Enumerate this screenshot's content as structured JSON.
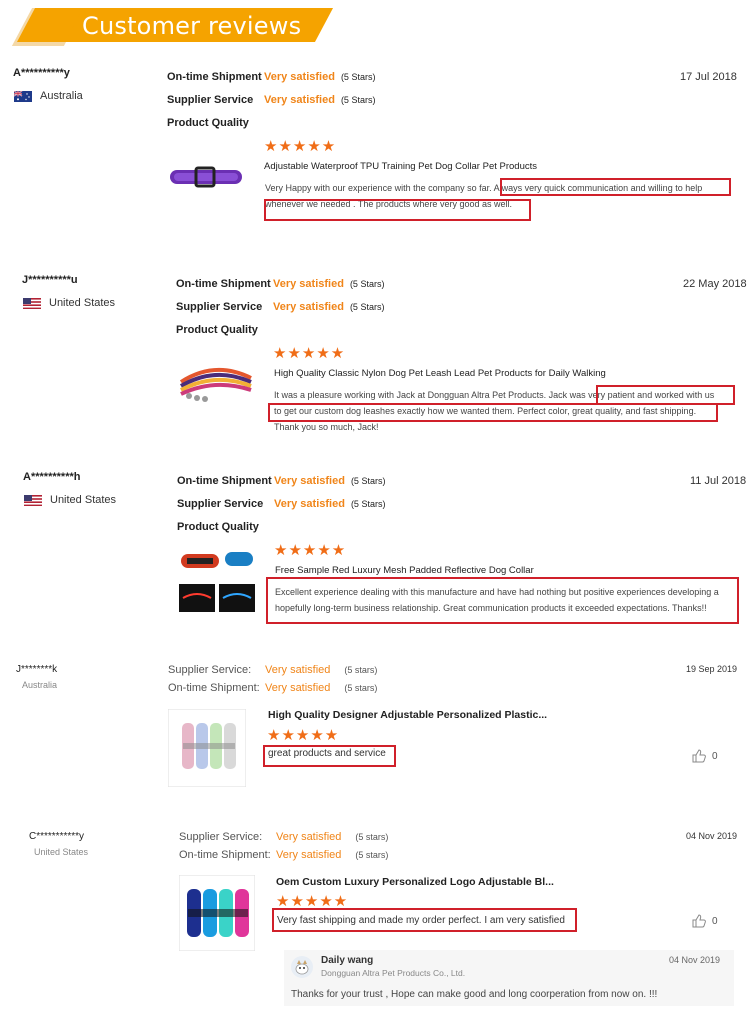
{
  "banner": {
    "title": "Customer reviews"
  },
  "reviews": [
    {
      "user": "A**********y",
      "country": "Australia",
      "date": "17 Jul 2018",
      "m1": {
        "label": "On-time Shipment",
        "value": "Very satisfied",
        "stars": "(5 Stars)"
      },
      "m2": {
        "label": "Supplier Service",
        "value": "Very satisfied",
        "stars": "(5 Stars)"
      },
      "quality_label": "Product Quality",
      "rating_stars": "★★★★★",
      "product": "Adjustable Waterproof TPU Training Pet Dog Collar Pet Products",
      "c1": "Very Happy with our experience with the company so far. Always very quick communication and willing to help",
      "c2": "whenever we needed . The products where very good as well."
    },
    {
      "user": "J**********u",
      "country": "United States",
      "date": "22 May 2018",
      "m1": {
        "label": "On-time Shipment",
        "value": "Very satisfied",
        "stars": "(5 Stars)"
      },
      "m2": {
        "label": "Supplier Service",
        "value": "Very satisfied",
        "stars": "(5 Stars)"
      },
      "quality_label": "Product Quality",
      "rating_stars": "★★★★★",
      "product": "High Quality Classic Nylon Dog Pet Leash Lead Pet Products for Daily Walking",
      "c1": "It was a pleasure working with Jack at Dongguan Altra Pet Products. Jack was very patient and worked with us",
      "c2": "to get our custom dog leashes exactly how we wanted them. Perfect color, great quality, and fast shipping.",
      "c3": "Thank you so much, Jack!"
    },
    {
      "user": "A**********h",
      "country": "United States",
      "date": "11 Jul 2018",
      "m1": {
        "label": "On-time Shipment",
        "value": "Very satisfied",
        "stars": "(5 Stars)"
      },
      "m2": {
        "label": "Supplier Service",
        "value": "Very satisfied",
        "stars": "(5 Stars)"
      },
      "quality_label": "Product Quality",
      "rating_stars": "★★★★★",
      "product": "Free Sample Red Luxury Mesh Padded Reflective Dog Collar",
      "c1": "Excellent experience dealing with this manufacture and have had nothing but positive experiences developing a",
      "c2": "hopefully long-term business relationship. Great communication products it exceeded expectations. Thanks!!"
    },
    {
      "user": "J********k",
      "country": "Australia",
      "date": "19 Sep 2019",
      "m1": {
        "label": "Supplier Service:",
        "value": "Very satisfied",
        "stars": "(5 stars)"
      },
      "m2": {
        "label": "On-time Shipment:",
        "value": "Very satisfied",
        "stars": "(5 stars)"
      },
      "rating_stars": "★★★★★",
      "product": "High Quality Designer Adjustable Personalized Plastic...",
      "c1": "great products and service",
      "likes": "0"
    },
    {
      "user": "C***********y",
      "country": "United States",
      "date": "04 Nov 2019",
      "m1": {
        "label": "Supplier Service:",
        "value": "Very satisfied",
        "stars": "(5 stars)"
      },
      "m2": {
        "label": "On-time Shipment:",
        "value": "Very satisfied",
        "stars": "(5 stars)"
      },
      "rating_stars": "★★★★★",
      "product": "Oem Custom Luxury Personalized Logo Adjustable Bl...",
      "c1": "Very fast shipping and made my order perfect. I am very satisfied",
      "likes": "0"
    }
  ],
  "reply": {
    "name": "Daily wang",
    "company": "Dongguan Altra Pet Products Co., Ltd.",
    "date": "04 Nov 2019",
    "text": "Thanks for your trust , Hope can make good and long coorperation from now on. !!!"
  },
  "colors": {
    "accent": "#f5a300",
    "star": "#f06d17",
    "satisfied": "#f08519",
    "highlight": "#d0202a"
  }
}
